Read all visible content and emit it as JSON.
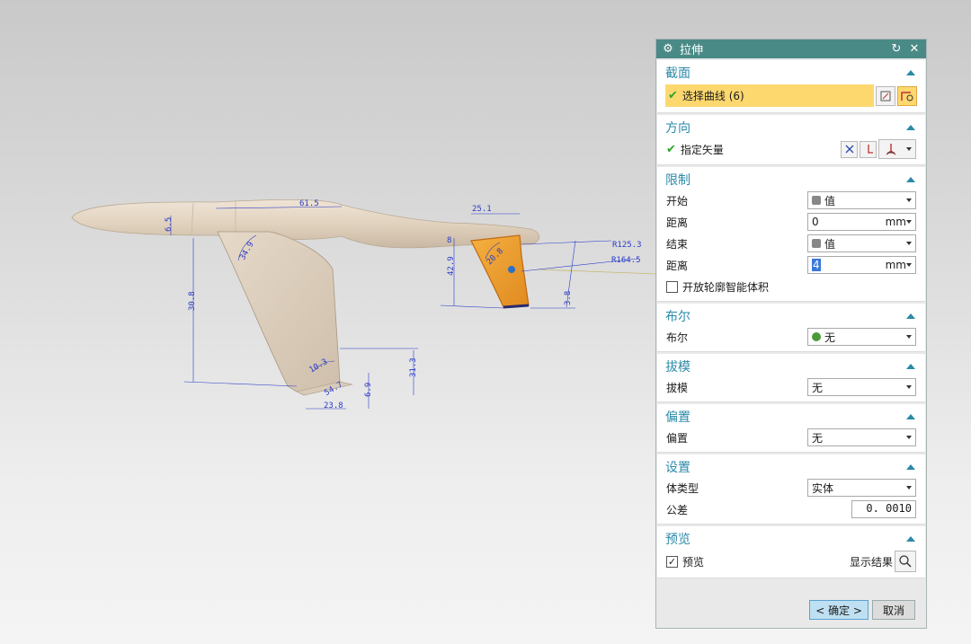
{
  "dialog": {
    "title": "拉伸",
    "sections": {
      "section_curve": {
        "header": "截面",
        "select_curve_label": "选择曲线 (6)"
      },
      "direction": {
        "header": "方向",
        "vector_label": "指定矢量"
      },
      "limits": {
        "header": "限制",
        "start_label": "开始",
        "start_value": "值",
        "distance1_label": "距离",
        "distance1_value": "0",
        "distance1_unit": "mm",
        "end_label": "结束",
        "end_value": "值",
        "distance2_label": "距离",
        "distance2_value": "4",
        "distance2_unit": "mm",
        "open_profile_label": "开放轮廓智能体积"
      },
      "boolean": {
        "header": "布尔",
        "label": "布尔",
        "value": "无"
      },
      "draft": {
        "header": "拔模",
        "label": "拔模",
        "value": "无"
      },
      "offset": {
        "header": "偏置",
        "label": "偏置",
        "value": "无"
      },
      "settings": {
        "header": "设置",
        "body_type_label": "体类型",
        "body_type_value": "实体",
        "tolerance_label": "公差",
        "tolerance_value": "0. 0010"
      },
      "preview": {
        "header": "预览",
        "preview_label": "预览",
        "show_result_label": "显示结果"
      }
    },
    "buttons": {
      "ok": "< 确定 >",
      "cancel": "取消"
    }
  },
  "dimensions": {
    "d1": "61.5",
    "d2": "6.5",
    "d3": "34.9",
    "d4": "30.8",
    "d5": "10.3",
    "d6": "54.7",
    "d7": "23.8",
    "d8": "6.9",
    "d9": "31.3",
    "d10": "25.1",
    "d11": "42.9",
    "d12": "R125.3",
    "d13": "R164.5",
    "d14": "3.8",
    "d15": "20.8",
    "d16": "8"
  },
  "colors": {
    "title_bar": "#4a8a86",
    "section_header": "#2a8aa8",
    "highlight": "#fdd86f",
    "model_body": "#e6d9c8",
    "model_selected": "#f0a030",
    "dimension_text": "#2a3cc8"
  }
}
